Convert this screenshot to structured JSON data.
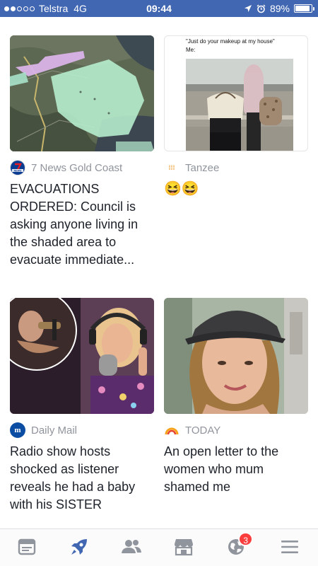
{
  "status_bar": {
    "carrier": "Telstra",
    "network": "4G",
    "time": "09:44",
    "battery": "89%",
    "battery_level": 0.89
  },
  "cards": [
    {
      "source_name": "7 News Gold Coast",
      "source_icon": "7news-logo-icon",
      "headline": "EVACUATIONS ORDERED: Council is asking anyone living in the shaded area to evacuate immediate..."
    },
    {
      "source_name": "Tanzee",
      "source_icon": "tanzee-logo-icon",
      "headline": "😆😆",
      "image_caption_top": "\"Just do your makeup at my house\"",
      "image_caption_sub": "Me:"
    },
    {
      "source_name": "Daily Mail",
      "source_icon": "daily-mail-logo-icon",
      "headline": "Radio show hosts shocked as listener reveals he had a baby with his SISTER"
    },
    {
      "source_name": "TODAY",
      "source_icon": "today-logo-icon",
      "headline": "An open letter to the women who mum shamed me"
    }
  ],
  "bottom_nav": {
    "items": [
      "news-feed",
      "explore",
      "friends",
      "marketplace",
      "notifications",
      "menu"
    ],
    "notifications_count": "3"
  },
  "colors": {
    "brand": "#4267b2",
    "active_tab": "#4267b2",
    "inactive_tab": "#90949c",
    "badge": "#fa3e3e"
  }
}
